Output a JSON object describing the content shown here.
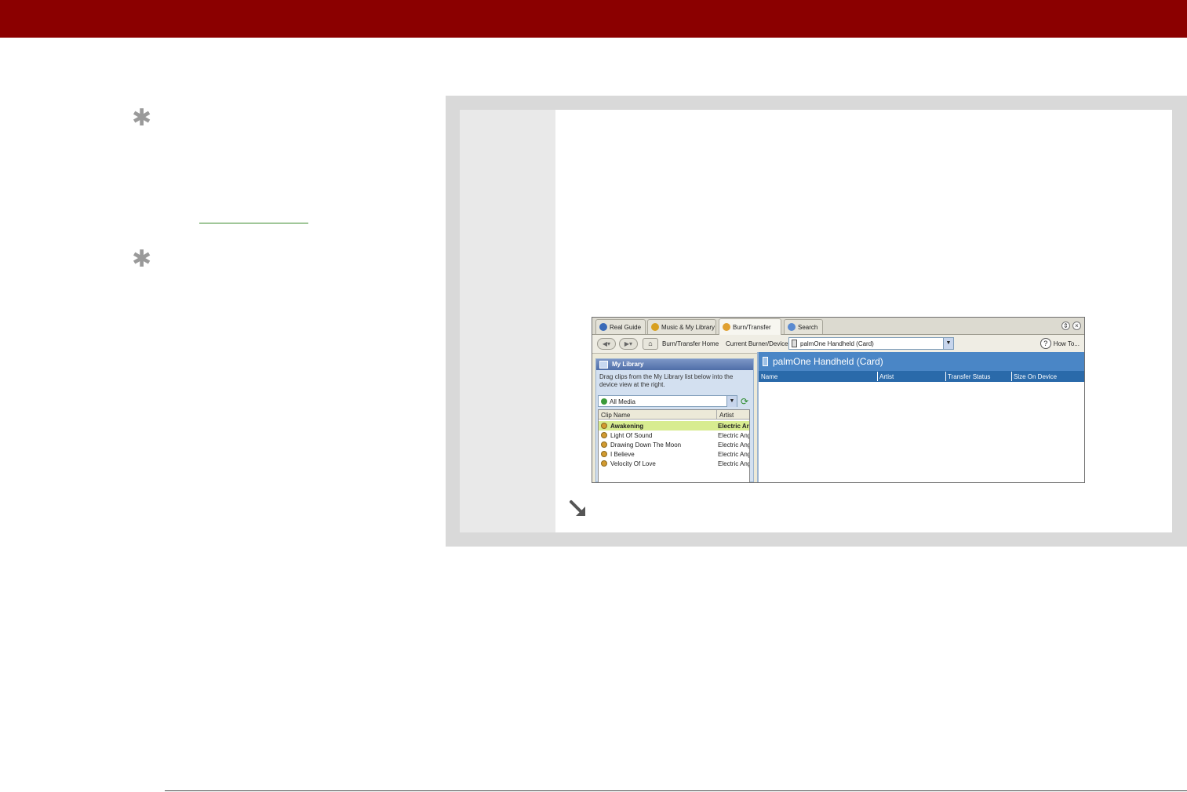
{
  "realplayer": {
    "tabs": [
      {
        "label": "Real Guide",
        "icon": "real-guide-icon"
      },
      {
        "label": "Music & My Library",
        "icon": "music-icon"
      },
      {
        "label": "Burn/Transfer",
        "icon": "burn-icon"
      },
      {
        "label": "Search",
        "icon": "search-icon"
      }
    ],
    "toolbar": {
      "home_label": "Burn/Transfer Home",
      "current_device_label": "Current Burner/Device",
      "device_value": "palmOne Handheld (Card)",
      "how_to_label": "How To..."
    },
    "library": {
      "title": "My Library",
      "description": "Drag clips from the My Library list below into the device view at the right.",
      "media_filter": "All Media",
      "columns": [
        "Clip Name",
        "Artist"
      ],
      "clips": [
        {
          "name": "Awakening",
          "artist": "Electric Ar"
        },
        {
          "name": "Light Of Sound",
          "artist": "Electric Ang"
        },
        {
          "name": "Drawing Down The Moon",
          "artist": "Electric Ang"
        },
        {
          "name": "I Believe",
          "artist": "Electric Ang"
        },
        {
          "name": "Velocity Of Love",
          "artist": "Electric Ang"
        }
      ]
    },
    "device": {
      "title": "palmOne Handheld (Card)",
      "columns": [
        "Name",
        "Artist",
        "Transfer Status",
        "Size On Device"
      ]
    }
  },
  "colors": {
    "header_bar": "#8b0000",
    "tip_link": "#3a8a2a",
    "panel_outer": "#d9d9d9",
    "panel_step": "#e9e9e9"
  }
}
